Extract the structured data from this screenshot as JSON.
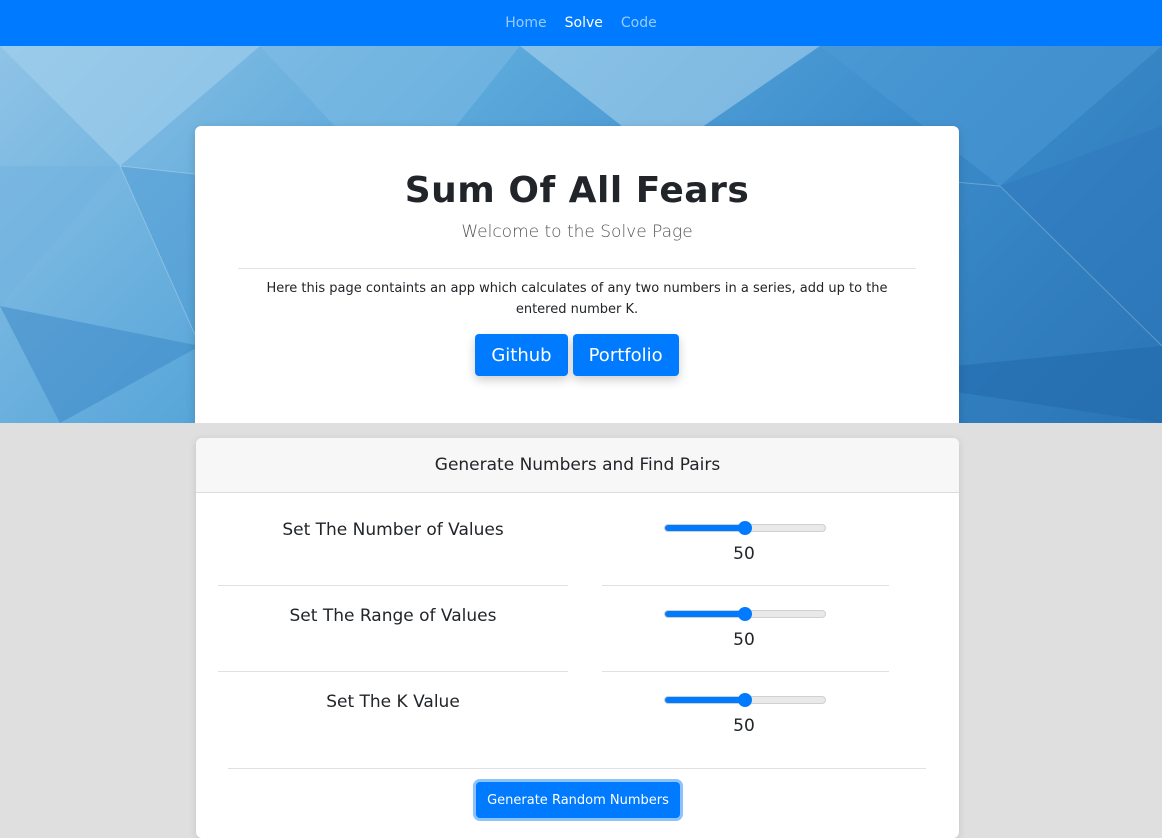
{
  "nav": {
    "items": [
      {
        "label": "Home",
        "active": false
      },
      {
        "label": "Solve",
        "active": true
      },
      {
        "label": "Code",
        "active": false
      }
    ]
  },
  "hero": {
    "title": "Sum Of All Fears",
    "subtitle": "Welcome to the Solve Page",
    "description": "Here this page containts an app which calculates of any two numbers in a series, add up to the entered number K.",
    "buttons": [
      {
        "label": "Github"
      },
      {
        "label": "Portfolio"
      }
    ]
  },
  "solve": {
    "header": "Generate Numbers and Find Pairs",
    "controls": [
      {
        "label": "Set The Number of Values",
        "value": "50",
        "fraction": 0.5
      },
      {
        "label": "Set The Range of Values",
        "value": "50",
        "fraction": 0.5
      },
      {
        "label": "Set The K Value",
        "value": "50",
        "fraction": 0.5
      }
    ],
    "generate_label": "Generate Random Numbers"
  },
  "colors": {
    "primary": "#007bff",
    "page_bg": "#dfdfdf"
  }
}
